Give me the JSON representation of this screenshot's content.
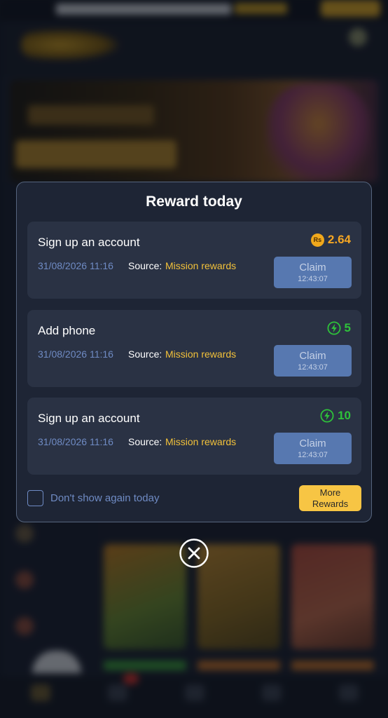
{
  "background": {
    "topbar_text": "DOWNLOAD THE APP GET",
    "topbar_highlight": "GET BONUS"
  },
  "modal": {
    "title": "Reward today",
    "rewards": [
      {
        "title": "Sign up an account",
        "reward_icon": "rupee-coin-icon",
        "reward_value": "2.64",
        "date": "31/08/2026 11:16",
        "source_label": "Source:",
        "source": "Mission rewards",
        "claim_label": "Claim",
        "claim_timer": "12:43:07"
      },
      {
        "title": "Add phone",
        "reward_icon": "lightning-icon",
        "reward_value": "5",
        "date": "31/08/2026 11:16",
        "source_label": "Source:",
        "source": "Mission rewards",
        "claim_label": "Claim",
        "claim_timer": "12:43:07"
      },
      {
        "title": "Sign up an account",
        "reward_icon": "lightning-icon",
        "reward_value": "10",
        "date": "31/08/2026 11:16",
        "source_label": "Source:",
        "source": "Mission rewards",
        "claim_label": "Claim",
        "claim_timer": "12:43:07"
      }
    ],
    "coin_glyph": "Rs",
    "dont_show_label": "Don't show again today",
    "dont_show_checked": false,
    "more_rewards_line1": "More",
    "more_rewards_line2": "Rewards"
  },
  "colors": {
    "accent_gold": "#f7c544",
    "reward_gold": "#f5a623",
    "reward_green": "#2ec23a",
    "claim_button": "#5778b0",
    "link_blue": "#6f8bc4"
  }
}
